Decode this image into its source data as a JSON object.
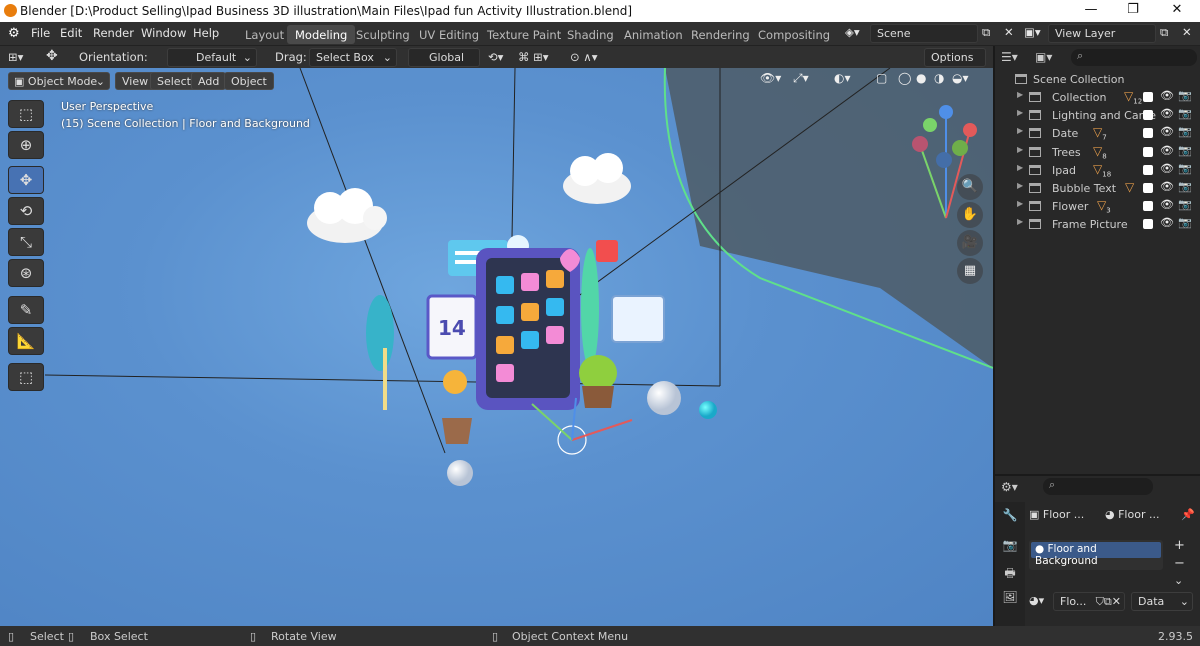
{
  "window": {
    "title": "Blender [D:\\Product Selling\\Ipad Business 3D illustration\\Main Files\\Ipad fun Activity Illustration.blend]",
    "minimize": "—",
    "maximize": "❐",
    "close": "✕"
  },
  "menu": [
    "File",
    "Edit",
    "Render",
    "Window",
    "Help"
  ],
  "workspaces": [
    "Layout",
    "Modeling",
    "Sculpting",
    "UV Editing",
    "Texture Paint",
    "Shading",
    "Animation",
    "Rendering",
    "Compositing"
  ],
  "active_workspace": "Modeling",
  "scene": {
    "name": "Scene",
    "view_layer": "View Layer"
  },
  "header": {
    "orientation_label": "Orientation:",
    "orientation_value": "Default",
    "drag_label": "Drag:",
    "drag_value": "Select Box",
    "transform_value": "Global",
    "options_label": "Options"
  },
  "viewport_header": {
    "mode": "Object Mode",
    "menus": [
      "View",
      "Select",
      "Add",
      "Object"
    ]
  },
  "viewport": {
    "perspective": "User Perspective",
    "context": "(15) Scene Collection | Floor and Background",
    "calendar_day": "14"
  },
  "outliner": {
    "root": "Scene Collection",
    "rows": [
      {
        "name": "Collection",
        "count": "12"
      },
      {
        "name": "Lighting and Came",
        "count": ""
      },
      {
        "name": "Date",
        "count": "7"
      },
      {
        "name": "Trees",
        "count": "8"
      },
      {
        "name": "Ipad",
        "count": "18"
      },
      {
        "name": "Bubble Text",
        "count": ""
      },
      {
        "name": "Flower",
        "count": "3"
      },
      {
        "name": "Frame Picture",
        "count": ""
      }
    ]
  },
  "properties": {
    "object_name": "Floor ...",
    "material_name": "Floor ...",
    "material_slot": "Floor and Background",
    "material_field": "Flo...",
    "data_label": "Data"
  },
  "status": {
    "select": "Select",
    "box_select": "Box Select",
    "rotate_view": "Rotate View",
    "context_menu": "Object Context Menu",
    "version": "2.93.5"
  }
}
